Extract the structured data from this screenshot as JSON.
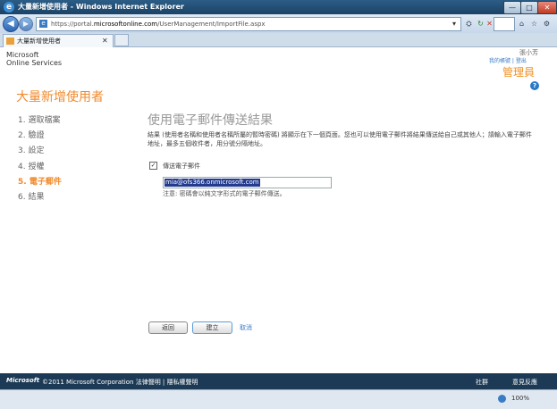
{
  "window": {
    "title": "大量新增使用者 - Windows Internet Explorer",
    "controls": {
      "minimize": "—",
      "maximize": "□",
      "close": "✕"
    }
  },
  "browser": {
    "url_prefix": "https://portal.",
    "url_domain": "microsoftonline.com",
    "url_path": "/UserManagement/ImportFile.aspx",
    "tab_label": "大量新增使用者",
    "tab_close": "✕",
    "back_icon": "◀",
    "forward_icon": "▶",
    "toolbar_icons": {
      "dropdown": "▾",
      "compat": "⛭",
      "refresh": "↻",
      "stop": "✕",
      "home": "⌂",
      "favorites": "☆",
      "tools": "⚙"
    },
    "zoom": "100%"
  },
  "header": {
    "brand_line1": "Microsoft",
    "brand_line2": "Online Services",
    "user_name": "張小芳",
    "links": "我的帳號 | 登出",
    "role": "管理員",
    "help": "?"
  },
  "page": {
    "heading": "大量新增使用者",
    "steps": [
      {
        "label": "1.  選取檔案"
      },
      {
        "label": "2.  驗證"
      },
      {
        "label": "3.  設定"
      },
      {
        "label": "4.  授權"
      },
      {
        "label": "5.  電子郵件"
      },
      {
        "label": "6.  結果"
      }
    ],
    "section_title": "使用電子郵件傳送結果",
    "description": "結果 (使用者名稱和使用者名稱所屬的暫時密碼) 將顯示在下一個頁面。您也可以使用電子郵件將結果傳送給自己或其他人；請輸入電子郵件地址，最多五個收件者，用分號分隔地址。",
    "send_email_checked": "✓",
    "send_email_label": "傳送電子郵件",
    "email_value": "mia@ofs366.onmicrosoft.com",
    "note": "注意: 密碼會以純文字形式的電子郵件傳送。",
    "buttons": {
      "back": "返回",
      "create": "建立",
      "cancel": "取消"
    }
  },
  "footer": {
    "logo": "Microsoft",
    "copyright": "©2011 Microsoft Corporation  法律聲明  |  隱私權聲明",
    "community": "社群",
    "feedback": "意見反應"
  },
  "colors": {
    "accent": "#f08a2c",
    "footer_bg": "#1c3a55",
    "link": "#3a7bc4"
  }
}
